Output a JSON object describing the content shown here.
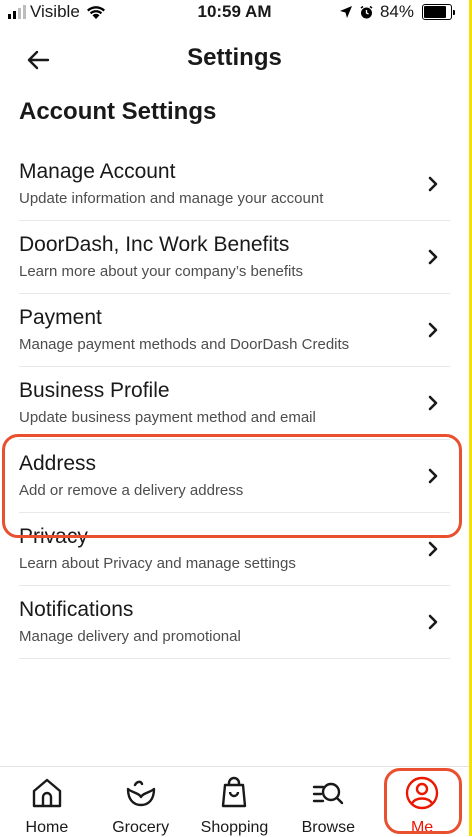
{
  "status_bar": {
    "carrier": "Visible",
    "time": "10:59 AM",
    "battery": "84%",
    "battery_level": 0.84
  },
  "header": {
    "title": "Settings",
    "back_icon": "arrow-left-icon"
  },
  "section": {
    "title": "Account Settings"
  },
  "settings": [
    {
      "title": "Manage Account",
      "desc": "Update information and manage your account"
    },
    {
      "title": "DoorDash, Inc Work Benefits",
      "desc": "Learn more about your company’s benefits"
    },
    {
      "title": "Payment",
      "desc": "Manage payment methods and DoorDash Credits"
    },
    {
      "title": "Business Profile",
      "desc": "Update business payment method and email"
    },
    {
      "title": "Address",
      "desc": "Add or remove a delivery address"
    },
    {
      "title": "Privacy",
      "desc": "Learn about Privacy and manage settings"
    },
    {
      "title": "Notifications",
      "desc": "Manage delivery and promotional"
    }
  ],
  "bottom_nav": [
    {
      "label": "Home",
      "icon": "home-icon"
    },
    {
      "label": "Grocery",
      "icon": "grocery-icon"
    },
    {
      "label": "Shopping",
      "icon": "shopping-bag-icon"
    },
    {
      "label": "Browse",
      "icon": "browse-search-icon"
    },
    {
      "label": "Me",
      "icon": "account-icon"
    }
  ],
  "colors": {
    "accent": "#eb1700",
    "highlight": "#e8502f"
  }
}
